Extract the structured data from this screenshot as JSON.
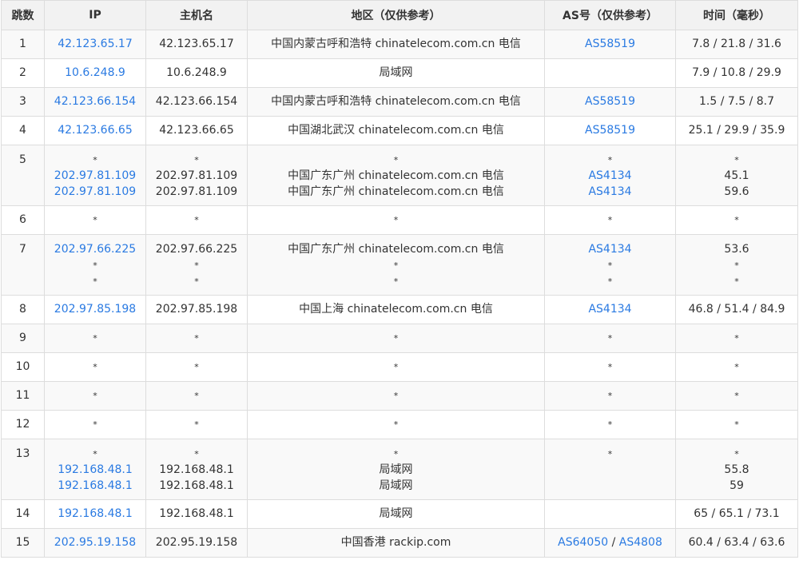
{
  "headers": [
    "跳数",
    "IP",
    "主机名",
    "地区（仅供参考）",
    "AS号（仅供参考）",
    "时间（毫秒）"
  ],
  "rows": [
    {
      "hop": "1",
      "ip": [
        "42.123.65.17"
      ],
      "host": [
        "42.123.65.17"
      ],
      "region": [
        "中国内蒙古呼和浩特 chinatelecom.com.cn 电信"
      ],
      "as": [
        [
          "AS58519"
        ]
      ],
      "time": [
        "7.8 / 21.8 / 31.6"
      ]
    },
    {
      "hop": "2",
      "ip": [
        "10.6.248.9"
      ],
      "host": [
        "10.6.248.9"
      ],
      "region": [
        "局域网"
      ],
      "as": [
        []
      ],
      "time": [
        "7.9 / 10.8 / 29.9"
      ]
    },
    {
      "hop": "3",
      "ip": [
        "42.123.66.154"
      ],
      "host": [
        "42.123.66.154"
      ],
      "region": [
        "中国内蒙古呼和浩特 chinatelecom.com.cn 电信"
      ],
      "as": [
        [
          "AS58519"
        ]
      ],
      "time": [
        "1.5 / 7.5 / 8.7"
      ]
    },
    {
      "hop": "4",
      "ip": [
        "42.123.66.65"
      ],
      "host": [
        "42.123.66.65"
      ],
      "region": [
        "中国湖北武汉 chinatelecom.com.cn 电信"
      ],
      "as": [
        [
          "AS58519"
        ]
      ],
      "time": [
        "25.1 / 29.9 / 35.9"
      ]
    },
    {
      "hop": "5",
      "ip": [
        "*",
        "202.97.81.109",
        "202.97.81.109"
      ],
      "host": [
        "*",
        "202.97.81.109",
        "202.97.81.109"
      ],
      "region": [
        "*",
        "中国广东广州 chinatelecom.com.cn 电信",
        "中国广东广州 chinatelecom.com.cn 电信"
      ],
      "as": [
        [
          "*"
        ],
        [
          "AS4134"
        ],
        [
          "AS4134"
        ]
      ],
      "time": [
        "*",
        "45.1",
        "59.6"
      ]
    },
    {
      "hop": "6",
      "ip": [
        "*"
      ],
      "host": [
        "*"
      ],
      "region": [
        "*"
      ],
      "as": [
        [
          "*"
        ]
      ],
      "time": [
        "*"
      ]
    },
    {
      "hop": "7",
      "ip": [
        "202.97.66.225",
        "*",
        "*"
      ],
      "host": [
        "202.97.66.225",
        "*",
        "*"
      ],
      "region": [
        "中国广东广州 chinatelecom.com.cn 电信",
        "*",
        "*"
      ],
      "as": [
        [
          "AS4134"
        ],
        [
          "*"
        ],
        [
          "*"
        ]
      ],
      "time": [
        "53.6",
        "*",
        "*"
      ]
    },
    {
      "hop": "8",
      "ip": [
        "202.97.85.198"
      ],
      "host": [
        "202.97.85.198"
      ],
      "region": [
        "中国上海 chinatelecom.com.cn 电信"
      ],
      "as": [
        [
          "AS4134"
        ]
      ],
      "time": [
        "46.8 / 51.4 / 84.9"
      ]
    },
    {
      "hop": "9",
      "ip": [
        "*"
      ],
      "host": [
        "*"
      ],
      "region": [
        "*"
      ],
      "as": [
        [
          "*"
        ]
      ],
      "time": [
        "*"
      ]
    },
    {
      "hop": "10",
      "ip": [
        "*"
      ],
      "host": [
        "*"
      ],
      "region": [
        "*"
      ],
      "as": [
        [
          "*"
        ]
      ],
      "time": [
        "*"
      ]
    },
    {
      "hop": "11",
      "ip": [
        "*"
      ],
      "host": [
        "*"
      ],
      "region": [
        "*"
      ],
      "as": [
        [
          "*"
        ]
      ],
      "time": [
        "*"
      ]
    },
    {
      "hop": "12",
      "ip": [
        "*"
      ],
      "host": [
        "*"
      ],
      "region": [
        "*"
      ],
      "as": [
        [
          "*"
        ]
      ],
      "time": [
        "*"
      ]
    },
    {
      "hop": "13",
      "ip": [
        "*",
        "192.168.48.1",
        "192.168.48.1"
      ],
      "host": [
        "*",
        "192.168.48.1",
        "192.168.48.1"
      ],
      "region": [
        "*",
        "局域网",
        "局域网"
      ],
      "as": [
        [
          "*"
        ],
        [],
        []
      ],
      "time": [
        "*",
        "55.8",
        "59"
      ]
    },
    {
      "hop": "14",
      "ip": [
        "192.168.48.1"
      ],
      "host": [
        "192.168.48.1"
      ],
      "region": [
        "局域网"
      ],
      "as": [
        []
      ],
      "time": [
        "65 / 65.1 / 73.1"
      ]
    },
    {
      "hop": "15",
      "ip": [
        "202.95.19.158"
      ],
      "host": [
        "202.95.19.158"
      ],
      "region": [
        "中国香港 rackip.com"
      ],
      "as": [
        [
          "AS64050",
          "AS4808"
        ]
      ],
      "time": [
        "60.4 / 63.4 / 63.6"
      ]
    }
  ],
  "as_separator": " / ",
  "colors": {
    "link": "#2a7ae2",
    "header_bg": "#f2f2f2",
    "odd_row_bg": "#f9f9f9",
    "border": "#dddddd"
  }
}
